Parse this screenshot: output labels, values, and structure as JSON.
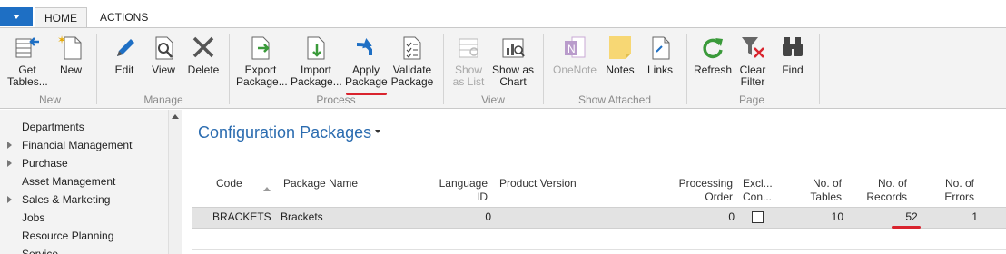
{
  "tabs": {
    "home": "HOME",
    "actions": "ACTIONS"
  },
  "ribbon": {
    "new_group": {
      "label": "New",
      "get_tables": [
        "Get",
        "Tables..."
      ],
      "new": "New"
    },
    "manage_group": {
      "label": "Manage",
      "edit": "Edit",
      "view": "View",
      "delete": "Delete"
    },
    "process_group": {
      "label": "Process",
      "export": [
        "Export",
        "Package..."
      ],
      "import": [
        "Import",
        "Package..."
      ],
      "apply": [
        "Apply",
        "Package"
      ],
      "validate": [
        "Validate",
        "Package"
      ]
    },
    "view_group": {
      "label": "View",
      "show_as_list": [
        "Show",
        "as List"
      ],
      "show_as_chart": [
        "Show as",
        "Chart"
      ]
    },
    "attached_group": {
      "label": "Show Attached",
      "onenote": "OneNote",
      "notes": "Notes",
      "links": "Links"
    },
    "page_group": {
      "label": "Page",
      "refresh": "Refresh",
      "clear_filter": [
        "Clear",
        "Filter"
      ],
      "find": "Find"
    }
  },
  "nav": {
    "items": [
      {
        "label": "Departments",
        "expandable": false
      },
      {
        "label": "Financial Management",
        "expandable": true
      },
      {
        "label": "Purchase",
        "expandable": true
      },
      {
        "label": "Asset Management",
        "expandable": false
      },
      {
        "label": "Sales & Marketing",
        "expandable": true
      },
      {
        "label": "Jobs",
        "expandable": false
      },
      {
        "label": "Resource Planning",
        "expandable": false
      },
      {
        "label": "Service",
        "expandable": false
      }
    ]
  },
  "main": {
    "title": "Configuration Packages",
    "columns": {
      "code": "Code",
      "package_name": "Package Name",
      "language_id": [
        "Language",
        "ID"
      ],
      "product_version": "Product Version",
      "processing_order": [
        "Processing",
        "Order"
      ],
      "exclude": [
        "Excl...",
        "Con..."
      ],
      "no_tables": [
        "No. of",
        "Tables"
      ],
      "no_records": [
        "No. of",
        "Records"
      ],
      "no_errors": [
        "No. of",
        "Errors"
      ]
    },
    "rows": [
      {
        "code": "BRACKETS",
        "package_name": "Brackets",
        "language_id": "0",
        "product_version": "",
        "processing_order": "0",
        "exclude": false,
        "no_tables": "10",
        "no_records": "52",
        "no_errors": "1"
      }
    ]
  },
  "colors": {
    "accent": "#1e6fc4",
    "title": "#2b6cb0",
    "highlight_underline": "#d9242e",
    "ribbon_bg": "#f3f3f3"
  }
}
